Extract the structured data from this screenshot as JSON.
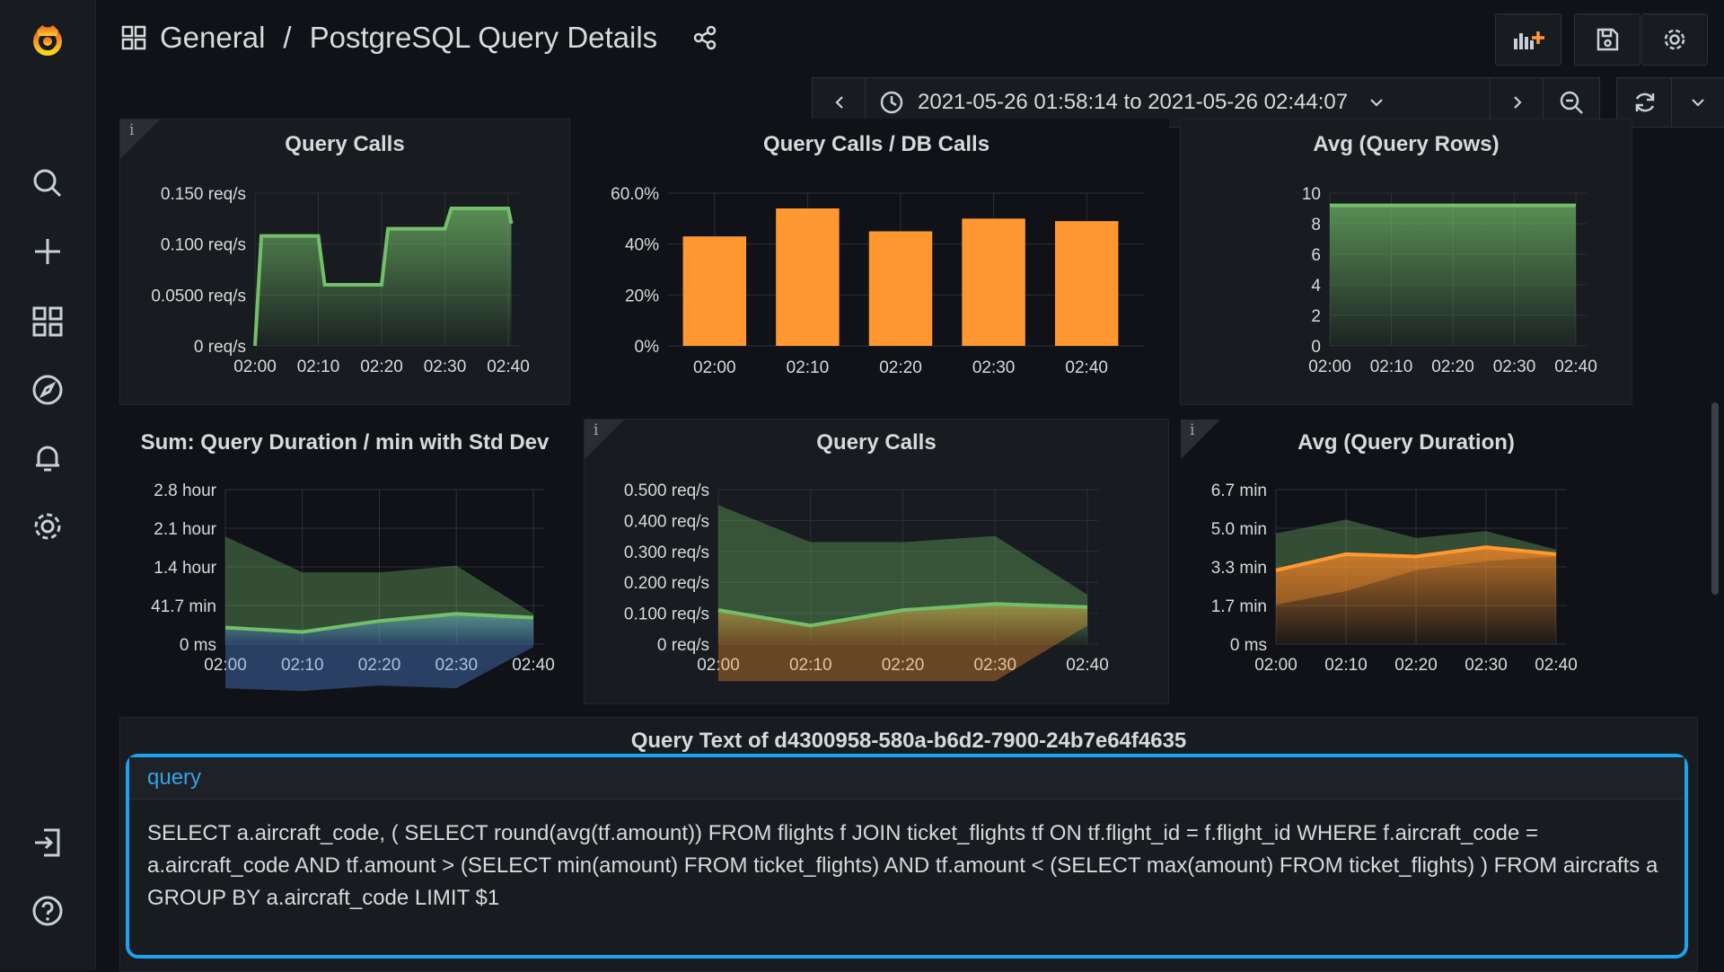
{
  "breadcrumb": {
    "folder": "General",
    "separator": "/",
    "dashboard": "PostgreSQL Query Details"
  },
  "time_range": {
    "label": "2021-05-26 01:58:14 to 2021-05-26 02:44:07"
  },
  "sidebar": {
    "icons": [
      "grafana-logo-icon",
      "search-icon",
      "plus-icon",
      "dashboards-icon",
      "explore-icon",
      "alerting-icon",
      "settings-icon",
      "sign-in-icon",
      "help-icon"
    ]
  },
  "colors": {
    "green": "#73bf69",
    "orange": "#ff9830",
    "blue": "#5794f2",
    "highlight": "#1aa3ef"
  },
  "panels": [
    {
      "id": "p1",
      "title": "Query Calls",
      "chart_data": {
        "type": "area",
        "x": [
          "02:00",
          "02:10",
          "02:20",
          "02:30",
          "02:40"
        ],
        "yticks": [
          "0 req/s",
          "0.0500 req/s",
          "0.100 req/s",
          "0.150 req/s"
        ],
        "ylim": [
          0,
          0.15
        ],
        "series": [
          {
            "values_step": [
              [
                0,
                0
              ],
              [
                0.1,
                0.108
              ],
              [
                1.0,
                0.108
              ],
              [
                1.1,
                0.06
              ],
              [
                2.0,
                0.06
              ],
              [
                2.1,
                0.115
              ],
              [
                3.0,
                0.115
              ],
              [
                3.1,
                0.135
              ],
              [
                4.0,
                0.135
              ],
              [
                4.05,
                0.12
              ]
            ],
            "color": "#73bf69"
          }
        ]
      }
    },
    {
      "id": "p2",
      "title": "Query Calls / DB Calls",
      "chart_data": {
        "type": "bar",
        "categories": [
          "02:00",
          "02:10",
          "02:20",
          "02:30",
          "02:40"
        ],
        "values": [
          43,
          54,
          45,
          50,
          49
        ],
        "yticks": [
          "0%",
          "20%",
          "40%",
          "60.0%"
        ],
        "ylim": [
          0,
          60
        ],
        "color": "#ff9830"
      }
    },
    {
      "id": "p3",
      "title": "Avg (Query Rows)",
      "chart_data": {
        "type": "area",
        "x": [
          "02:00",
          "02:10",
          "02:20",
          "02:30",
          "02:40"
        ],
        "yticks": [
          "0",
          "2",
          "4",
          "6",
          "8",
          "10"
        ],
        "ylim": [
          0,
          10
        ],
        "series": [
          {
            "values": [
              9.2,
              9.2,
              9.2,
              9.2,
              9.2
            ],
            "color": "#73bf69"
          }
        ]
      }
    },
    {
      "id": "p4",
      "title": "Sum: Query Duration / min with Std Dev",
      "chart_data": {
        "type": "area",
        "x": [
          "02:00",
          "02:10",
          "02:20",
          "02:30",
          "02:40"
        ],
        "yticks": [
          "0 ms",
          "41.7 min",
          "1.4 hour",
          "2.1 hour",
          "2.8 hour"
        ],
        "ylim": [
          0,
          2.8
        ],
        "series": [
          {
            "name": "",
            "values": [
              0.3,
              0.22,
              0.42,
              0.55,
              0.48
            ],
            "color": "#73bf69"
          },
          {
            "name": "",
            "values": [
              1.95,
              1.3,
              1.3,
              1.42,
              0.55
            ],
            "color": "#73bf69",
            "band": true
          },
          {
            "name": "",
            "values": [
              -0.8,
              -0.85,
              -0.75,
              -0.8,
              -0.05
            ],
            "color": "#5794f2",
            "band": true
          }
        ]
      }
    },
    {
      "id": "p5",
      "title": "Query Calls",
      "chart_data": {
        "type": "area",
        "x": [
          "02:00",
          "02:10",
          "02:20",
          "02:30",
          "02:40"
        ],
        "yticks": [
          "0 req/s",
          "0.100 req/s",
          "0.200 req/s",
          "0.300 req/s",
          "0.400 req/s",
          "0.500 req/s"
        ],
        "ylim": [
          0,
          0.5
        ],
        "series": [
          {
            "values": [
              0.11,
              0.06,
              0.11,
              0.13,
              0.12
            ],
            "color": "#73bf69"
          },
          {
            "values": [
              0.45,
              0.33,
              0.33,
              0.35,
              0.16
            ],
            "color": "#73bf69",
            "band": true
          },
          {
            "values": [
              -0.12,
              -0.12,
              -0.12,
              -0.12,
              0.06
            ],
            "color": "#ff9830",
            "band": true
          }
        ]
      }
    },
    {
      "id": "p6",
      "title": "Avg (Query Duration)",
      "chart_data": {
        "type": "area",
        "x": [
          "02:00",
          "02:10",
          "02:20",
          "02:30",
          "02:40"
        ],
        "yticks": [
          "0 ms",
          "1.7 min",
          "3.3 min",
          "5.0 min",
          "6.7 min"
        ],
        "ylim": [
          0,
          6.7
        ],
        "series": [
          {
            "values": [
              3.2,
              3.9,
              3.8,
              4.2,
              3.9
            ],
            "color": "#ff9830"
          },
          {
            "values": [
              4.8,
              5.4,
              4.6,
              4.9,
              4.1
            ],
            "color": "#73bf69",
            "band": true
          },
          {
            "values": [
              1.7,
              2.3,
              3.2,
              3.6,
              3.8
            ],
            "color": "#ff9830",
            "band": true
          }
        ]
      }
    }
  ],
  "query_panel": {
    "title": "Query Text of d4300958-580a-b6d2-7900-24b7e64f4635",
    "column": "query",
    "text": "SELECT a.aircraft_code, ( SELECT round(avg(tf.amount)) FROM flights f JOIN ticket_flights tf ON tf.flight_id = f.flight_id WHERE f.aircraft_code = a.aircraft_code AND tf.amount > (SELECT min(amount) FROM ticket_flights) AND tf.amount < (SELECT max(amount) FROM ticket_flights) ) FROM aircrafts a GROUP BY a.aircraft_code LIMIT $1"
  }
}
